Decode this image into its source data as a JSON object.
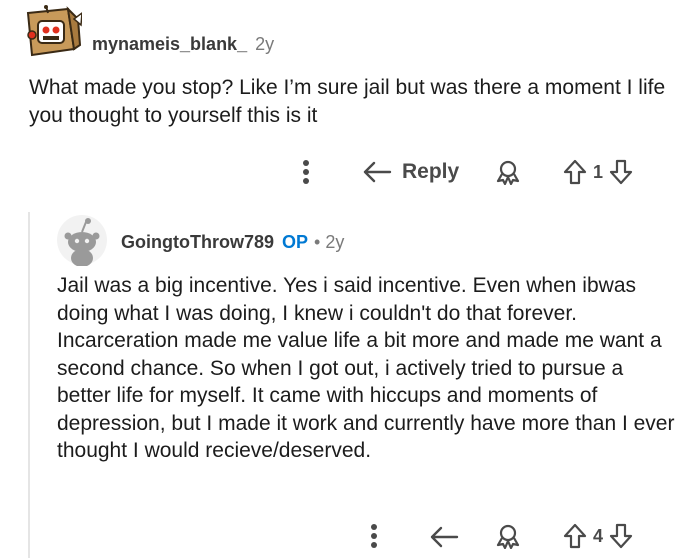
{
  "parent_comment": {
    "username": "mynameis_blank_",
    "age": "2y",
    "body": "What made you stop? Like I’m sure jail but was there a moment I life you thought to yourself this is it",
    "actions": {
      "more_icon": "more-vertical-icon",
      "reply_label": "Reply",
      "award_icon": "award-icon",
      "upvote_icon": "upvote-icon",
      "score": "1",
      "downvote_icon": "downvote-icon"
    }
  },
  "reply_comment": {
    "username": "GoingtoThrow789",
    "op_badge": "OP",
    "separator": "•",
    "age": "2y",
    "body": "Jail was a big incentive. Yes i said incentive. Even when ibwas doing what I was doing, I knew i couldn't do that forever. Incarceration made me value life a bit more and made me want a second chance. So when I got out, i actively tried to pursue a better life for myself. It came with hiccups and moments of depression, but I made it work and currently have more than I ever thought I would recieve/deserved.",
    "actions": {
      "more_icon": "more-vertical-icon",
      "reply_icon": "reply-arrow-icon",
      "award_icon": "award-icon",
      "upvote_icon": "upvote-icon",
      "score": "4",
      "downvote_icon": "downvote-icon"
    }
  },
  "colors": {
    "op_badge": "#0079d3",
    "thread_line": "#e5e5e5",
    "icon": "#4a4a4a"
  }
}
